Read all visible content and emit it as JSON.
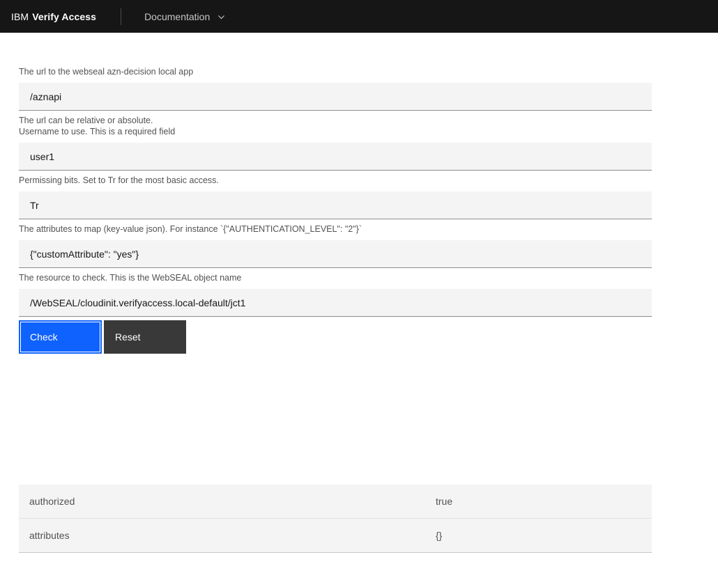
{
  "header": {
    "brand_prefix": "IBM",
    "brand_name": "Verify Access",
    "nav": {
      "documentation_label": "Documentation"
    }
  },
  "form": {
    "fields": [
      {
        "label": "The url to the webseal azn-decision local app",
        "value": "/aznapi",
        "helper": "The url can be relative or absolute."
      },
      {
        "label": "Username to use. This is a required field",
        "value": "user1"
      },
      {
        "label": "Permissing bits. Set to Tr for the most basic access.",
        "value": "Tr"
      },
      {
        "label": "The attributes to map (key-value json). For instance `{\"AUTHENTICATION_LEVEL\": \"2\"}`",
        "value": "{\"customAttribute\": \"yes\"}"
      },
      {
        "label": "The resource to check. This is the WebSEAL object name",
        "value": "/WebSEAL/cloudinit.verifyaccess.local-default/jct1"
      }
    ],
    "buttons": {
      "check_label": "Check",
      "reset_label": "Reset"
    }
  },
  "results_table": {
    "rows": [
      {
        "key": "authorized",
        "value": "true"
      },
      {
        "key": "attributes",
        "value": "{}"
      }
    ]
  },
  "colors": {
    "header_bg": "#161616",
    "accent": "#0f62fe",
    "secondary_button_bg": "#393939",
    "input_bg": "#f4f4f4",
    "table_bg": "#f4f4f4",
    "label_text": "#525252"
  }
}
